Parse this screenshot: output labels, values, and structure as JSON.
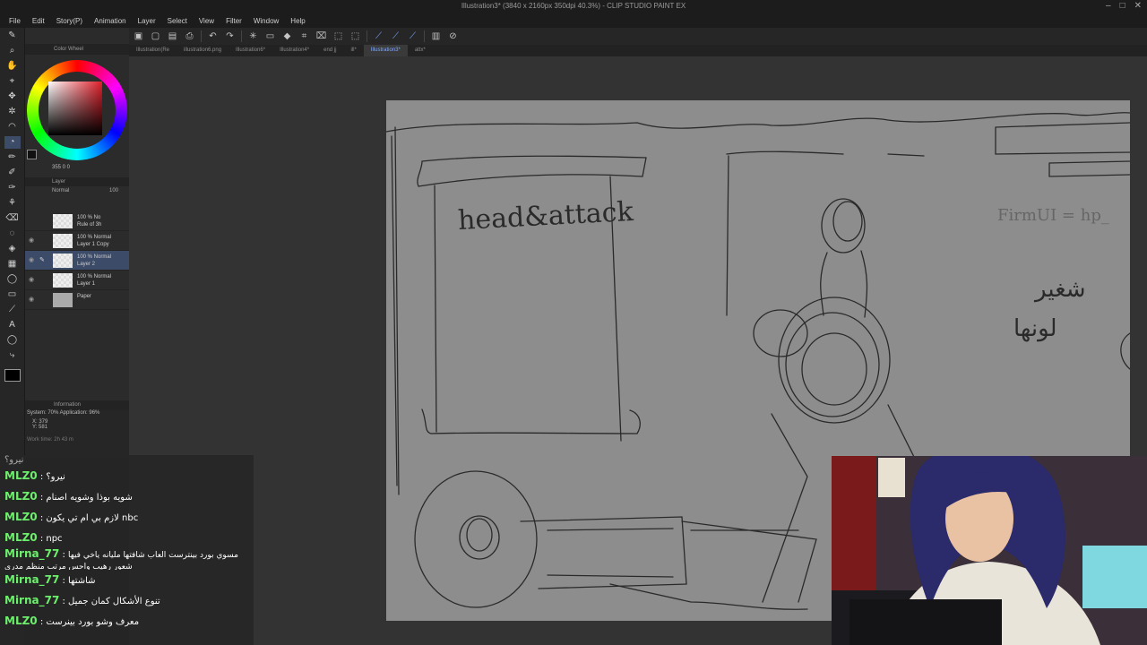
{
  "window": {
    "title": "Illustration3* (3840 x 2160px 350dpi 40.3%) - CLIP STUDIO PAINT EX",
    "controls": [
      "–",
      "□",
      "✕"
    ]
  },
  "menu": [
    "File",
    "Edit",
    "Story(P)",
    "Animation",
    "Layer",
    "Select",
    "View",
    "Filter",
    "Window",
    "Help"
  ],
  "tabs": [
    {
      "label": "Illustration(Re",
      "active": false
    },
    {
      "label": "illustration6.png",
      "active": false
    },
    {
      "label": "Illustration6*",
      "active": false
    },
    {
      "label": "Illustration4*",
      "active": false
    },
    {
      "label": "end jj",
      "active": false
    },
    {
      "label": "ill*",
      "active": false
    },
    {
      "label": "Illustration3*",
      "active": true
    },
    {
      "label": "attx*",
      "active": false
    }
  ],
  "color_panel": {
    "title": "Color Wheel",
    "readout": "355  0  0",
    "accent": "#e01f2a"
  },
  "layer_panel": {
    "title": "Layer",
    "blend_mode": "Normal",
    "opacity": "100",
    "layers": [
      {
        "line1": "100 % No",
        "line2": "Rule of 3h",
        "selected": false,
        "thumb": "transparent"
      },
      {
        "line1": "100 % Normal",
        "line2": "Layer 1 Copy",
        "selected": false,
        "thumb": "transparent"
      },
      {
        "line1": "100 % Normal",
        "line2": "Layer 2",
        "selected": true,
        "thumb": "transparent"
      },
      {
        "line1": "100 % Normal",
        "line2": "Layer 1",
        "selected": false,
        "thumb": "transparent"
      },
      {
        "line1": "",
        "line2": "Paper",
        "selected": false,
        "thumb": "paper"
      }
    ]
  },
  "info_panel": {
    "title": "Information",
    "system": "System: 70%  Application: 96%",
    "x": "X: 379",
    "y": "Y: 581",
    "work_time": "Work time:   2h 43 m"
  },
  "canvas": {
    "sketch_text": "head&attack",
    "right_note": "FirmUI = hp_",
    "arabic_note_1": "شغير",
    "arabic_note_2": "لونها"
  },
  "chat": [
    {
      "user": "",
      "message": "نيرو؟"
    },
    {
      "user": "MLZ0",
      "message": "نيرو؟"
    },
    {
      "user": "MLZ0",
      "message": "شويه بوذا وشويه اصنام"
    },
    {
      "user": "MLZ0",
      "message": "لازم بي ام تي يكون nbc"
    },
    {
      "user": "MLZ0",
      "message": "npc"
    },
    {
      "user": "Mirna_77",
      "message": "مسوي بورد بينترست العاب شافتها مليانه ياخي فيها شعور رهيب واحس مرتب منظم مدري"
    },
    {
      "user": "Mirna_77",
      "message": "شاشتها"
    },
    {
      "user": "Mirna_77",
      "message": "تنوع الأشكال كمان جميل"
    },
    {
      "user": "MLZ0",
      "message": "معرف وشو بورد بينرست"
    }
  ],
  "separator": " : "
}
